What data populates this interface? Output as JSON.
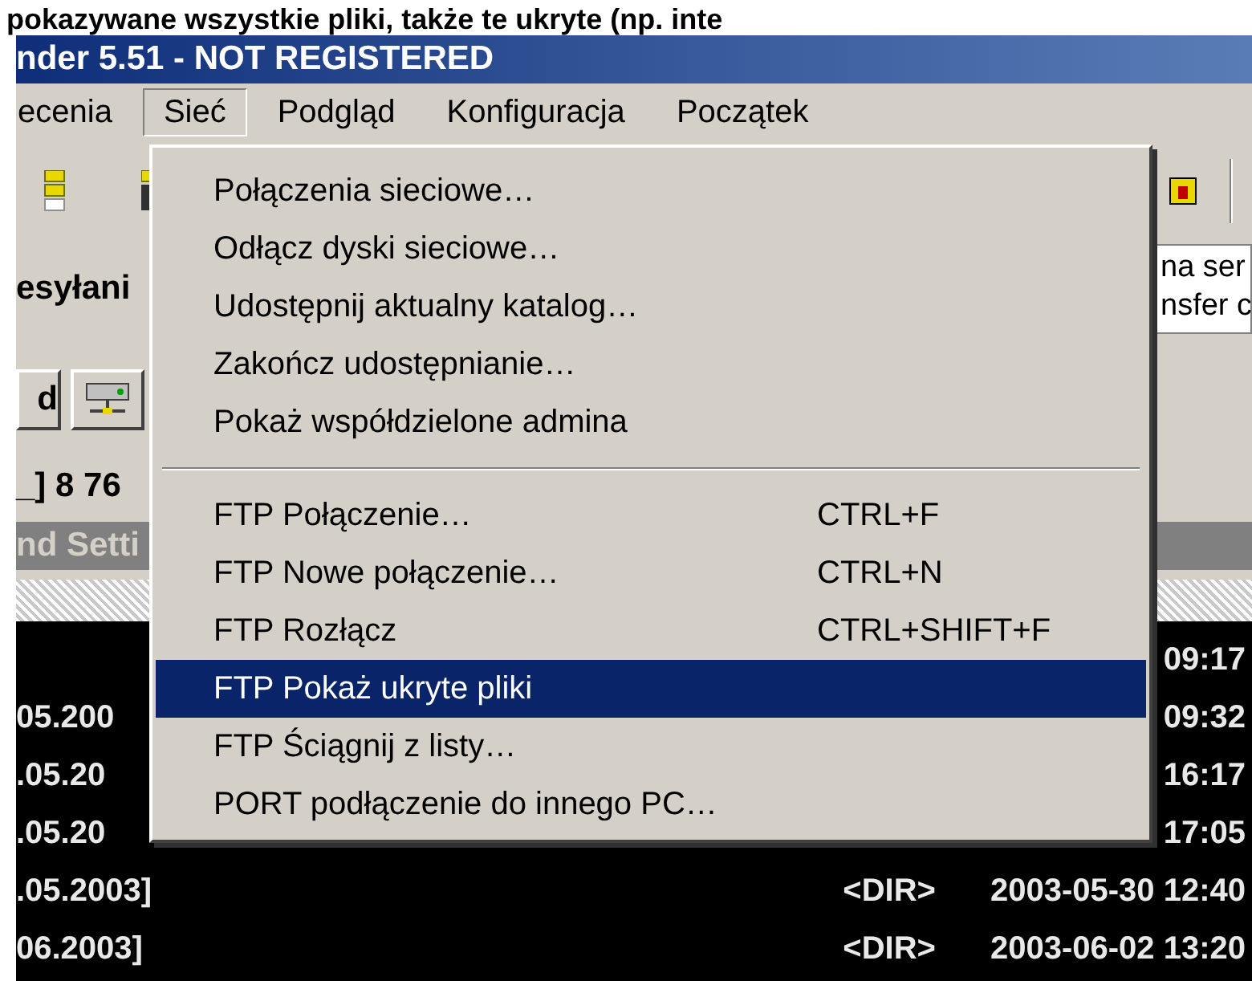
{
  "caption": "pokazywane wszystkie pliki, także te ukryte (np. inte",
  "window": {
    "title": "nder 5.51 - NOT REGISTERED"
  },
  "menu_bar": [
    {
      "label": "ecenia",
      "selected": false
    },
    {
      "label": "Sieć",
      "selected": true
    },
    {
      "label": "Podgląd",
      "selected": false
    },
    {
      "label": "Konfiguracja",
      "selected": false
    },
    {
      "label": "Początek",
      "selected": false
    }
  ],
  "panel": {
    "label": "esyłani",
    "info_lines": [
      "na ser",
      "nsfer c"
    ],
    "drive_button": "d",
    "free_space": "_] 8 76",
    "path_header": "nd Setti"
  },
  "file_list": [
    {
      "time": "09:17"
    },
    {
      "name": "05.200",
      "time": "09:32"
    },
    {
      "name": ".05.20",
      "time": "16:17"
    },
    {
      "name": ".05.20",
      "time": "17:05"
    },
    {
      "name": ".05.2003]",
      "size": "<DIR>",
      "date": "2003-05-30 12:40"
    },
    {
      "name": "06.2003]",
      "size": "<DIR>",
      "date": "2003-06-02 13:20"
    }
  ],
  "dropdown": [
    {
      "kind": "item",
      "label": "Połączenia sieciowe…",
      "selected": false
    },
    {
      "kind": "item",
      "label": "Odłącz dyski sieciowe…",
      "selected": false
    },
    {
      "kind": "item",
      "label": "Udostępnij aktualny katalog…",
      "selected": false
    },
    {
      "kind": "item",
      "label": "Zakończ udostępnianie…",
      "selected": false
    },
    {
      "kind": "item",
      "label": "Pokaż współdzielone admina",
      "selected": false
    },
    {
      "kind": "separator"
    },
    {
      "kind": "item",
      "label": "FTP Połączenie…",
      "shortcut": "CTRL+F",
      "selected": false
    },
    {
      "kind": "item",
      "label": "FTP Nowe połączenie…",
      "shortcut": "CTRL+N",
      "selected": false
    },
    {
      "kind": "item",
      "label": "FTP Rozłącz",
      "shortcut": "CTRL+SHIFT+F",
      "selected": false
    },
    {
      "kind": "item",
      "label": "FTP Pokaż ukryte pliki",
      "selected": true
    },
    {
      "kind": "item",
      "label": "FTP Ściągnij z listy…",
      "selected": false
    },
    {
      "kind": "item",
      "label": "PORT podłączenie do innego PC…",
      "selected": false
    }
  ]
}
